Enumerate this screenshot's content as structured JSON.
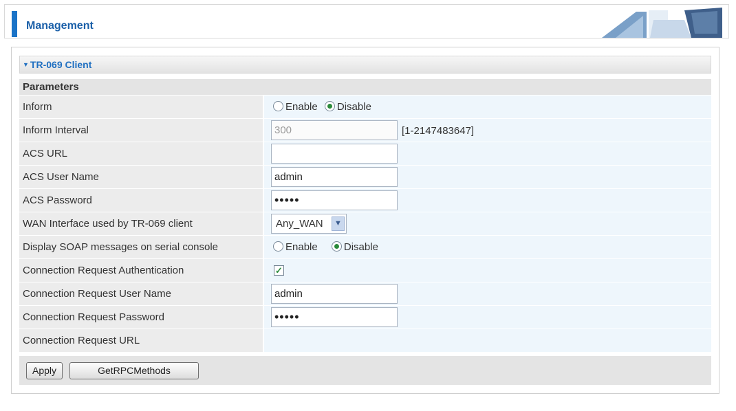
{
  "header": {
    "title": "Management"
  },
  "section": {
    "title": "TR-069 Client",
    "parameters_heading": "Parameters"
  },
  "fields": {
    "inform": {
      "label": "Inform",
      "options": [
        "Enable",
        "Disable"
      ],
      "selected": "Disable"
    },
    "inform_interval": {
      "label": "Inform Interval",
      "value": "300",
      "hint": "[1-2147483647]"
    },
    "acs_url": {
      "label": "ACS URL",
      "value": ""
    },
    "acs_user": {
      "label": "ACS User Name",
      "value": "admin"
    },
    "acs_password": {
      "label": "ACS Password",
      "value": "•••••"
    },
    "wan_interface": {
      "label": "WAN Interface used by TR-069 client",
      "value": "Any_WAN"
    },
    "soap_display": {
      "label": "Display SOAP messages on serial console",
      "options": [
        "Enable",
        "Disable"
      ],
      "selected": "Disable"
    },
    "conn_auth": {
      "label": "Connection Request Authentication",
      "checked": true
    },
    "conn_user": {
      "label": "Connection Request User Name",
      "value": "admin"
    },
    "conn_password": {
      "label": "Connection Request Password",
      "value": "•••••"
    },
    "conn_url": {
      "label": "Connection Request URL",
      "value": ""
    }
  },
  "buttons": {
    "apply": "Apply",
    "get_rpc": "GetRPCMethods"
  },
  "colors": {
    "accent": "#1a73c7",
    "title": "#1f6fc1",
    "value_bg": "#eef6fc",
    "label_bg": "#ececec"
  }
}
